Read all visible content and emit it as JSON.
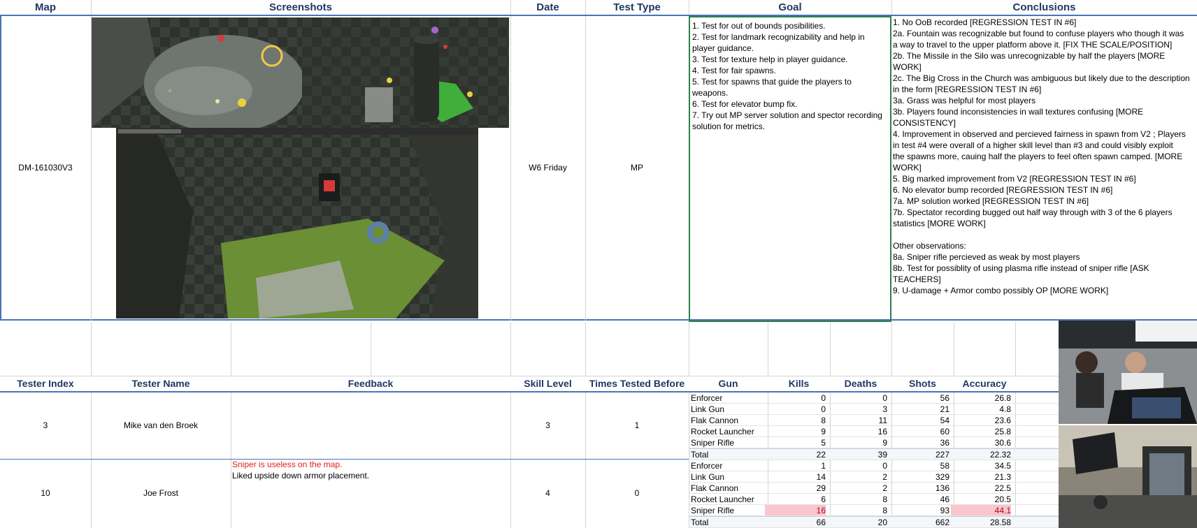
{
  "top_headers": {
    "map": "Map",
    "screenshots": "Screenshots",
    "date": "Date",
    "test_type": "Test Type",
    "goal": "Goal",
    "conclusions": "Conclusions"
  },
  "test_row": {
    "map": "DM-161030V3",
    "date": "W6 Friday",
    "test_type": "MP",
    "goals": [
      "1. Test for out of bounds posibilities.",
      "2. Test for landmark recognizability and help in",
      "player guidance.",
      "3. Test for texture help in player guidance.",
      "4. Test for fair spawns.",
      "5. Test for spawns that guide the players to",
      "weapons.",
      "6. Test for elevator bump fix.",
      "7. Try out MP server solution and spector recording",
      "solution for metrics."
    ],
    "conclusions": [
      "1. No OoB recorded [REGRESSION TEST IN #6]",
      "2a. Fountain was recognizable but found to confuse players who though it was",
      "a way to travel to the upper platform above it. [FIX THE SCALE/POSITION]",
      "2b. The Missile in the Silo was unrecognizable by half the players [MORE",
      "WORK]",
      "2c. The Big Cross in the Church was ambiguous but likely due to the description",
      "in the form [REGRESSION TEST IN #6]",
      "3a. Grass was helpful for most players",
      "3b. Players found inconsistencies in wall textures confusing [MORE",
      "CONSISTENCY]",
      "4. Improvement in observed and percieved fairness in spawn from V2 ; Players",
      "in test #4 were overall of a higher skill level than #3 and could visibly exploit",
      "the spawns more, cauing half the players to feel often spawn camped. [MORE",
      "WORK]",
      "5. Big marked improvement from V2 [REGRESSION TEST IN #6]",
      "6. No elevator bump recorded [REGRESSION TEST IN #6]",
      "7a. MP solution worked [REGRESSION TEST IN #6]",
      "7b. Spectator recording bugged out half way through with 3 of the 6 players",
      "statistics [MORE WORK]",
      "",
      "Other observations:",
      "8a. Sniper rifle percieved as weak by most players",
      "8b. Test for possiblity of using plasma rifle instead of sniper rifle [ASK",
      "TEACHERS]",
      "9. U-damage + Armor combo possibly OP [MORE WORK]"
    ]
  },
  "tester_headers": {
    "index": "Tester Index",
    "name": "Tester Name",
    "feedback": "Feedback",
    "skill": "Skill Level",
    "times": "Times Tested Before",
    "gun": "Gun",
    "kills": "Kills",
    "deaths": "Deaths",
    "shots": "Shots",
    "accuracy": "Accuracy"
  },
  "testers": [
    {
      "index": "3",
      "name": "Mike van den Broek",
      "feedback_red": "",
      "feedback": "",
      "skill": "3",
      "times": "1",
      "rows": [
        {
          "gun": "Enforcer",
          "kills": "0",
          "deaths": "0",
          "shots": "56",
          "accuracy": "26.8"
        },
        {
          "gun": "Link Gun",
          "kills": "0",
          "deaths": "3",
          "shots": "21",
          "accuracy": "4.8"
        },
        {
          "gun": "Flak Cannon",
          "kills": "8",
          "deaths": "11",
          "shots": "54",
          "accuracy": "23.6"
        },
        {
          "gun": "Rocket Launcher",
          "kills": "9",
          "deaths": "16",
          "shots": "60",
          "accuracy": "25.8"
        },
        {
          "gun": "Sniper Rifle",
          "kills": "5",
          "deaths": "9",
          "shots": "36",
          "accuracy": "30.6"
        },
        {
          "gun": "Total",
          "kills": "22",
          "deaths": "39",
          "shots": "227",
          "accuracy": "22.32"
        }
      ]
    },
    {
      "index": "10",
      "name": "Joe Frost",
      "feedback_red": "Sniper is useless on the map.",
      "feedback": "Liked upside down armor placement.",
      "skill": "4",
      "times": "0",
      "rows": [
        {
          "gun": "Enforcer",
          "kills": "1",
          "deaths": "0",
          "shots": "58",
          "accuracy": "34.5"
        },
        {
          "gun": "Link Gun",
          "kills": "14",
          "deaths": "2",
          "shots": "329",
          "accuracy": "21.3"
        },
        {
          "gun": "Flak Cannon",
          "kills": "29",
          "deaths": "2",
          "shots": "136",
          "accuracy": "22.5"
        },
        {
          "gun": "Rocket Launcher",
          "kills": "6",
          "deaths": "8",
          "shots": "46",
          "accuracy": "20.5"
        },
        {
          "gun": "Sniper Rifle",
          "kills": "16",
          "deaths": "8",
          "shots": "93",
          "accuracy": "44.1"
        },
        {
          "gun": "Total",
          "kills": "66",
          "deaths": "20",
          "shots": "662",
          "accuracy": "28.58"
        }
      ]
    }
  ],
  "colors": {
    "header_text": "#1f3864",
    "blue_border": "#4a72b8",
    "goal_border": "#2e7d4f",
    "red_text": "#e0201b",
    "highlight": "#f8c6cc"
  }
}
